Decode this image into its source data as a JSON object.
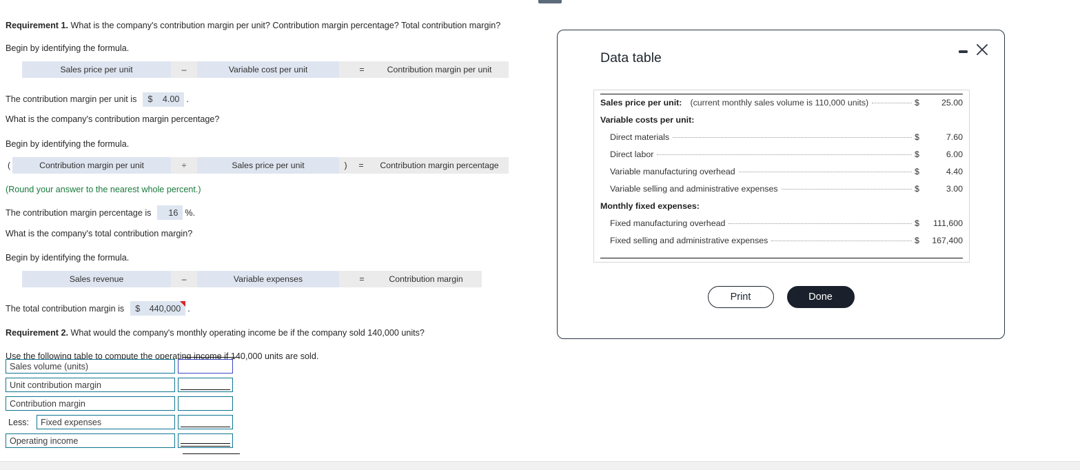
{
  "worksheet": {
    "req1": {
      "label": "Requirement 1.",
      "question": "What is the company's contribution margin per unit? Contribution margin percentage? Total contribution margin?",
      "begin": "Begin by identifying the formula.",
      "formula1": {
        "open": "",
        "term1": "Sales price per unit",
        "op1": "–",
        "term2": "Variable cost per unit",
        "close": "",
        "op2": "=",
        "result": "Contribution margin per unit"
      },
      "answer1_prefix": "The contribution margin per unit is",
      "answer1_currency": "$",
      "answer1_value": "4.00",
      "answer1_suffix": ".",
      "q2": "What is the company's contribution margin percentage?",
      "begin2": "Begin by identifying the formula.",
      "formula2": {
        "open": "(",
        "term1": "Contribution margin per unit",
        "op1": "÷",
        "term2": "Sales price per unit",
        "close": ")",
        "op2": "=",
        "result": "Contribution margin percentage"
      },
      "round_note": "(Round your answer to the nearest whole percent.)",
      "answer2_prefix": "The contribution margin percentage is",
      "answer2_value": "16",
      "answer2_suffix": "%.",
      "q3": "What is the company's total contribution margin?",
      "begin3": "Begin by identifying the formula.",
      "formula3": {
        "open": "",
        "term1": "Sales revenue",
        "op1": "–",
        "term2": "Variable expenses",
        "close": "",
        "op2": "=",
        "result": "Contribution margin"
      },
      "answer3_prefix": "The total contribution margin is",
      "answer3_currency": "$",
      "answer3_value": "440,000",
      "answer3_suffix": "."
    },
    "req2": {
      "label": "Requirement 2.",
      "question": "What would the company's monthly operating income be if the company sold 140,000 units?",
      "instruction": "Use the following table to compute the operating income if 140,000 units are sold.",
      "less_label": "Less:",
      "rows": [
        {
          "label": "Sales volume (units)",
          "value": "",
          "indent": false,
          "underline": "none",
          "focus": true
        },
        {
          "label": "Unit contribution margin",
          "value": "",
          "indent": false,
          "underline": "single",
          "focus": false
        },
        {
          "label": "Contribution margin",
          "value": "",
          "indent": false,
          "underline": "none",
          "focus": false
        },
        {
          "label": "Fixed expenses",
          "value": "",
          "indent": true,
          "underline": "single",
          "focus": false
        },
        {
          "label": "Operating income",
          "value": "",
          "indent": false,
          "underline": "double",
          "focus": false
        }
      ]
    }
  },
  "dialog": {
    "title": "Data table",
    "minimize_icon": "minimize-icon",
    "close_icon": "close-icon",
    "rows": [
      {
        "kind": "header_amount",
        "label": "Sales price per unit:",
        "note": "(current monthly sales volume is 110,000 units)",
        "currency": "$",
        "amount": "25.00"
      },
      {
        "kind": "header",
        "label": "Variable costs per unit:"
      },
      {
        "kind": "item",
        "label": "Direct materials",
        "currency": "$",
        "amount": "7.60"
      },
      {
        "kind": "item",
        "label": "Direct labor",
        "currency": "$",
        "amount": "6.00"
      },
      {
        "kind": "item",
        "label": "Variable manufacturing overhead",
        "currency": "$",
        "amount": "4.40"
      },
      {
        "kind": "item",
        "label": "Variable selling and administrative expenses",
        "currency": "$",
        "amount": "3.00"
      },
      {
        "kind": "header",
        "label": "Monthly fixed expenses:"
      },
      {
        "kind": "item",
        "label": "Fixed manufacturing overhead",
        "currency": "$",
        "amount": "111,600"
      },
      {
        "kind": "item",
        "label": "Fixed selling and administrative expenses",
        "currency": "$",
        "amount": "167,400"
      }
    ],
    "print_label": "Print",
    "done_label": "Done"
  },
  "colors": {
    "formula_term": "#dfe5f0",
    "formula_result": "#ebebeb",
    "answer_field": "#dde5f0",
    "flag_red": "#d4232a",
    "box_border": "#0e7490",
    "focus_border": "#3b46c4",
    "dialog_border": "#2b3442",
    "button_solid": "#1b212c",
    "note_green": "#1a7a3c"
  }
}
